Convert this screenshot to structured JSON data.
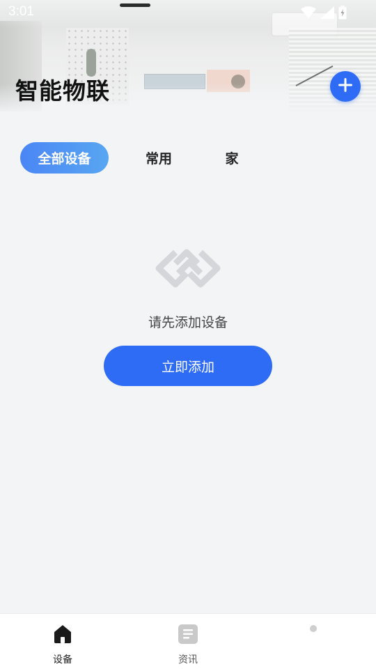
{
  "status_bar": {
    "time": "3:01",
    "icons": [
      "wifi-icon",
      "signal-icon",
      "battery-charging-icon"
    ]
  },
  "header": {
    "title": "智能物联",
    "add_icon": "plus-icon"
  },
  "tabs": [
    {
      "label": "全部设备",
      "active": true
    },
    {
      "label": "常用",
      "active": false
    },
    {
      "label": "家",
      "active": false
    }
  ],
  "empty_state": {
    "icon": "link-chain-icon",
    "message": "请先添加设备",
    "button_label": "立即添加"
  },
  "bottom_nav": {
    "items": [
      {
        "label": "设备",
        "icon": "home-icon",
        "active": true
      },
      {
        "label": "资讯",
        "icon": "document-icon",
        "active": false
      },
      {
        "label": "",
        "icon": "dot-icon",
        "active": false
      }
    ]
  },
  "colors": {
    "primary": "#2e6cf6",
    "tab_gradient_start": "#4a86f5",
    "tab_gradient_end": "#58a6f2",
    "background": "#f3f4f6",
    "title_text": "#111111"
  }
}
